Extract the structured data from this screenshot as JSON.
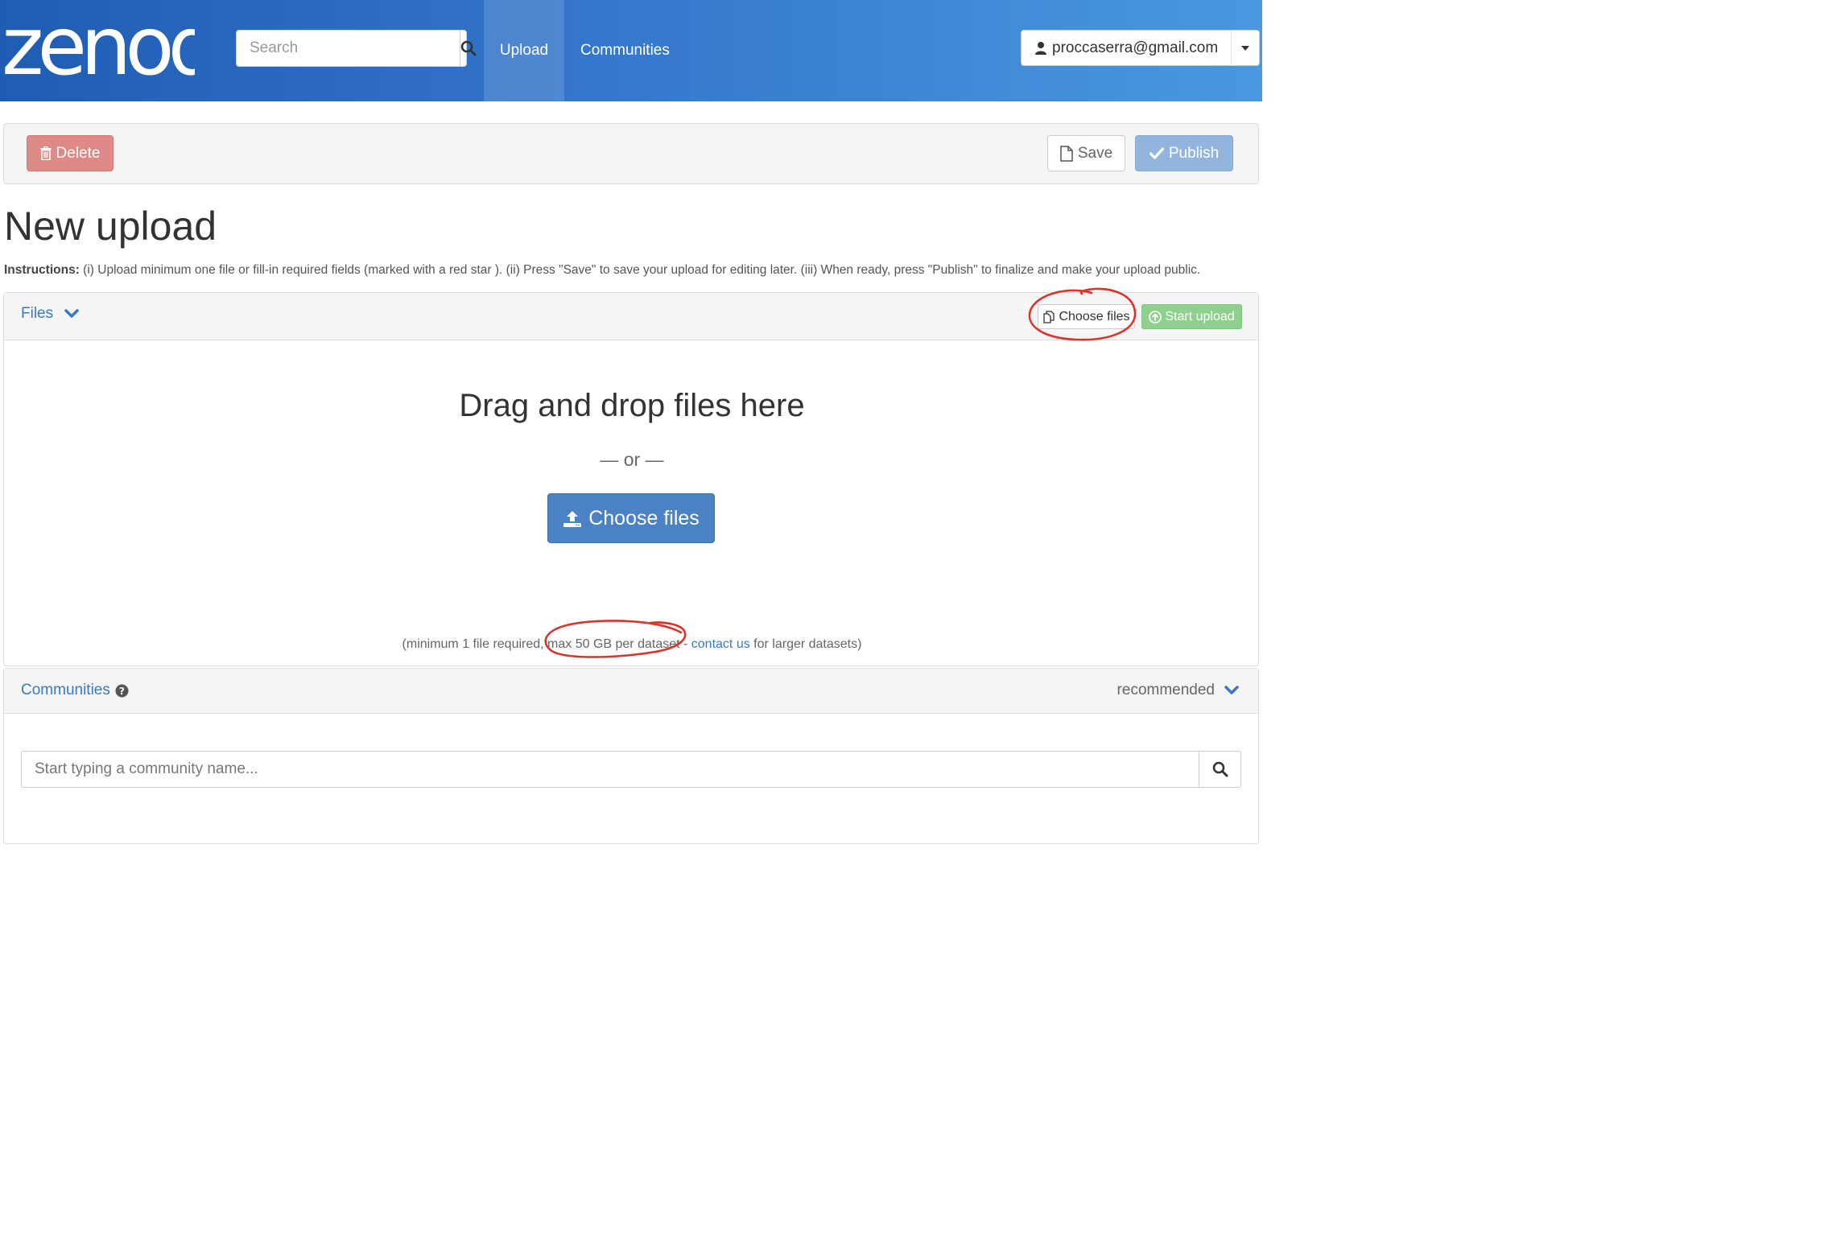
{
  "header": {
    "logo_text": "zenodo",
    "search_placeholder": "Search",
    "nav": [
      {
        "label": "Upload",
        "active": true
      },
      {
        "label": "Communities",
        "active": false
      }
    ],
    "user_email": "proccaserra@gmail.com"
  },
  "actions": {
    "delete_label": "Delete",
    "save_label": "Save",
    "publish_label": "Publish"
  },
  "page": {
    "title": "New upload",
    "instructions_label": "Instructions:",
    "instructions_text": " (i) Upload minimum one file or fill-in required fields (marked with a red star ). (ii) Press \"Save\" to save your upload for editing later. (iii) When ready, press \"Publish\" to finalize and make your upload public."
  },
  "files": {
    "title": "Files",
    "choose_files_small": "Choose files",
    "start_upload": "Start upload",
    "drop_title": "Drag and drop files here",
    "or_text": "— or —",
    "choose_files_large": "Choose files",
    "note_prefix": "(minimum 1 file required, max 50 GB per dataset - ",
    "note_link": "contact us",
    "note_suffix": " for larger datasets)"
  },
  "communities": {
    "title": "Communities",
    "recommended_label": "recommended",
    "search_placeholder": "Start typing a community name..."
  },
  "colors": {
    "header_start": "#1f5db3",
    "header_end": "#4a98e0",
    "link": "#3a7ac1",
    "delete": "#de8a86",
    "publish": "#92b5de",
    "start_upload": "#8fd08f",
    "annotation": "#d9342b"
  }
}
